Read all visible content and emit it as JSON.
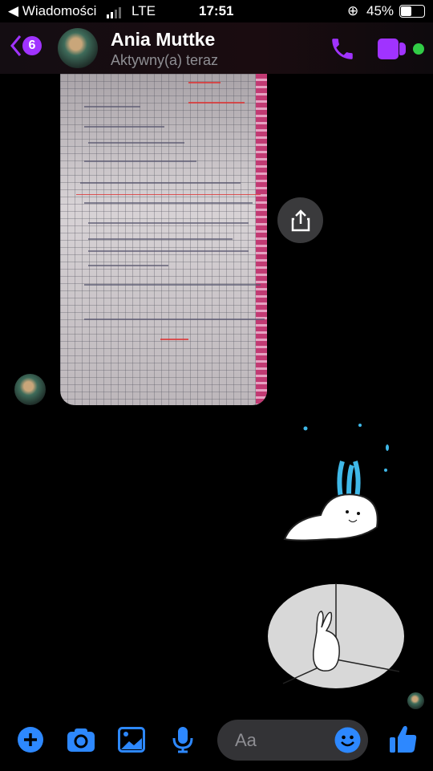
{
  "status_bar": {
    "back_app": "◀ Wiadomości",
    "carrier": "LTE",
    "time": "17:51",
    "battery": "45%"
  },
  "header": {
    "unread_count": "6",
    "contact_name": "Ania Muttke",
    "presence": "Aktywny(a) teraz"
  },
  "composer": {
    "placeholder": "Aa"
  },
  "colors": {
    "accent": "#a033ff",
    "composer_blue": "#2d88ff",
    "online": "#31cc46"
  }
}
